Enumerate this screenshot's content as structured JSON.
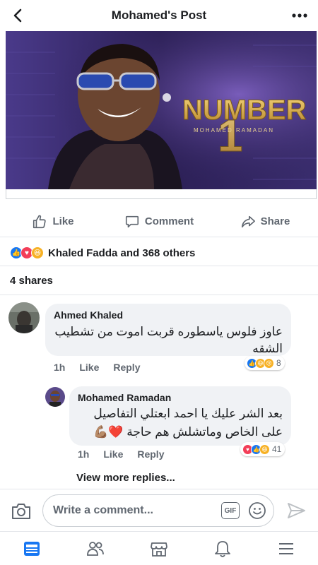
{
  "header": {
    "title": "Mohamed's Post",
    "back_icon": "chevron-left-icon",
    "more_icon": "more-horizontal-icon"
  },
  "post": {
    "image_title": "NUMBER",
    "image_number": "1",
    "image_subtitle": "MOHAMED RAMADAN",
    "actions": {
      "like": "Like",
      "comment": "Comment",
      "share": "Share"
    },
    "reactions_text": "Khaled Fadda and 368 others",
    "shares_text": "4 shares"
  },
  "comments": [
    {
      "author": "Ahmed Khaled",
      "text": "عاوز فلوس ياسطوره قربت اموت من تشطيب الشقه",
      "time": "1h",
      "like": "Like",
      "reply": "Reply",
      "reaction_count": "8"
    }
  ],
  "reply": {
    "author": "Mohamed Ramadan",
    "line1": "بعد الشر عليك يا احمد ابعتلي التفاصيل",
    "line2": "على الخاص وماتشلش هم حاجة ❤️💪🏽",
    "time": "1h",
    "like": "Like",
    "reply": "Reply",
    "reaction_count": "41"
  },
  "view_more_replies": "View more replies...",
  "composer": {
    "placeholder": "Write a comment...",
    "gif_label": "GIF"
  },
  "colors": {
    "accent": "#1877f2",
    "love": "#f33e58",
    "haha": "#f7b125",
    "muted": "#606770",
    "bubble": "#f0f2f5"
  }
}
